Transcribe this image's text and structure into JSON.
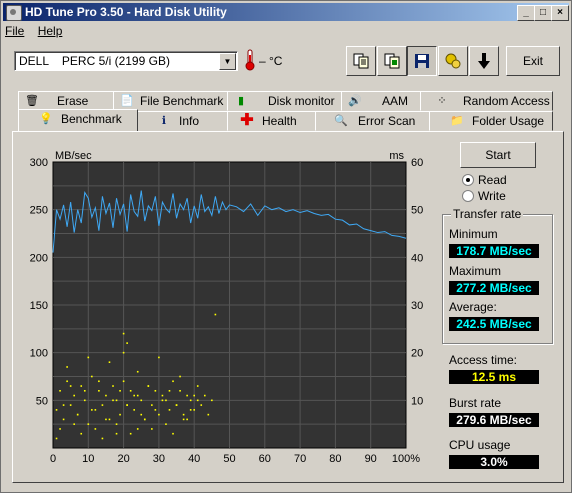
{
  "window": {
    "title": "HD Tune Pro 3.50 - Hard Disk Utility",
    "buttons": {
      "minimize": "_",
      "maximize": "□",
      "close": "×"
    }
  },
  "menu": [
    {
      "label": "File",
      "hotkey": "F"
    },
    {
      "label": "Help",
      "hotkey": "H"
    }
  ],
  "toolbar": {
    "drive": "DELL    PERC 5/i (2199 GB)",
    "temperature": "– °C",
    "icons": [
      "copy-text-icon",
      "copy-info-icon",
      "save-icon",
      "options-icon",
      "download-icon"
    ],
    "exit_label": "Exit"
  },
  "tabs_top": [
    {
      "label": "Erase",
      "icon": "trash-icon"
    },
    {
      "label": "File Benchmark",
      "icon": "file-benchmark-icon"
    },
    {
      "label": "Disk monitor",
      "icon": "disk-monitor-icon"
    },
    {
      "label": "AAM",
      "icon": "speaker-icon"
    },
    {
      "label": "Random Access",
      "icon": "random-access-icon"
    }
  ],
  "tabs_bottom": [
    {
      "label": "Benchmark",
      "icon": "lightbulb-icon",
      "active": true
    },
    {
      "label": "Info",
      "icon": "info-icon"
    },
    {
      "label": "Health",
      "icon": "health-cross-icon"
    },
    {
      "label": "Error Scan",
      "icon": "magnifier-icon"
    },
    {
      "label": "Folder Usage",
      "icon": "folder-icon"
    }
  ],
  "controls": {
    "start_label": "Start",
    "read_label": "Read",
    "write_label": "Write",
    "mode_selected": "Read"
  },
  "results": {
    "transfer_rate_title": "Transfer rate",
    "minimum_label": "Minimum",
    "minimum_value": "178.7 MB/sec",
    "maximum_label": "Maximum",
    "maximum_value": "277.2 MB/sec",
    "average_label": "Average:",
    "average_value": "242.5 MB/sec",
    "access_time_label": "Access time:",
    "access_time_value": "12.5 ms",
    "burst_rate_label": "Burst rate",
    "burst_rate_value": "279.6 MB/sec",
    "cpu_usage_label": "CPU usage",
    "cpu_usage_value": "3.0%"
  },
  "chart_data": {
    "type": "line",
    "left_unit": "MB/sec",
    "right_unit": "ms",
    "left_ticks": [
      50,
      100,
      150,
      200,
      250,
      300
    ],
    "right_ticks": [
      10,
      20,
      30,
      40,
      50,
      60
    ],
    "x_ticks": [
      "0",
      "10",
      "20",
      "30",
      "40",
      "50",
      "60",
      "70",
      "80",
      "90",
      "100%"
    ],
    "ylim": [
      0,
      300
    ],
    "y2lim": [
      0,
      60
    ],
    "xlim": [
      0,
      100
    ],
    "grid": true,
    "colors": {
      "background": "#333333",
      "grid": "#555555",
      "transfer": "#3fa9f5",
      "access": "#ffff00"
    },
    "series": [
      {
        "name": "Transfer rate",
        "axis": "left",
        "x": [
          0,
          1,
          2,
          3,
          4,
          5,
          6,
          7,
          8,
          9,
          10,
          11,
          12,
          13,
          14,
          15,
          16,
          17,
          18,
          19,
          20,
          21,
          22,
          23,
          24,
          25,
          26,
          27,
          28,
          29,
          30,
          31,
          32,
          33,
          34,
          35,
          36,
          37,
          38,
          39,
          40,
          41,
          42,
          43,
          44,
          45,
          46,
          47,
          48,
          49,
          50,
          52,
          54,
          56,
          58,
          60,
          62,
          64,
          66,
          68,
          70,
          72,
          74,
          76,
          78,
          80,
          82,
          84,
          86,
          88,
          90,
          92,
          94,
          96,
          98,
          100
        ],
        "values": [
          205,
          250,
          240,
          255,
          232,
          258,
          226,
          250,
          236,
          268,
          262,
          242,
          252,
          228,
          264,
          246,
          257,
          231,
          262,
          245,
          256,
          227,
          266,
          248,
          243,
          270,
          238,
          254,
          249,
          264,
          233,
          258,
          251,
          247,
          267,
          241,
          256,
          250,
          262,
          236,
          254,
          241,
          266,
          248,
          253,
          244,
          264,
          246,
          258,
          250,
          255,
          253,
          248,
          256,
          244,
          254,
          250,
          252,
          248,
          250,
          247,
          249,
          246,
          244,
          245,
          240,
          239,
          234,
          235,
          230,
          228,
          226,
          227,
          223,
          222,
          220
        ]
      },
      {
        "name": "Access time",
        "axis": "right",
        "x": [
          1,
          2,
          3,
          4,
          5,
          6,
          7,
          8,
          9,
          10,
          11,
          12,
          13,
          14,
          15,
          16,
          17,
          18,
          19,
          20,
          21,
          22,
          23,
          24,
          25,
          26,
          27,
          28,
          29,
          30,
          31,
          32,
          33,
          34,
          35,
          36,
          37,
          38,
          39,
          40,
          41,
          42,
          43,
          44,
          45,
          2,
          4,
          6,
          8,
          10,
          12,
          14,
          16,
          18,
          20,
          22,
          24,
          26,
          28,
          30,
          32,
          34,
          36,
          38,
          40,
          3,
          5,
          7,
          9,
          11,
          13,
          15,
          17,
          19,
          21,
          23,
          25,
          27,
          29,
          31,
          33,
          35,
          37,
          39,
          41,
          20,
          21,
          1,
          46,
          24,
          18
        ],
        "values": [
          8,
          12,
          6,
          14,
          9,
          11,
          7,
          13,
          10,
          5,
          15,
          8,
          12,
          9,
          11,
          6,
          13,
          10,
          7,
          14,
          9,
          12,
          8,
          11,
          10,
          6,
          13,
          9,
          12,
          7,
          11,
          10,
          8,
          14,
          9,
          12,
          7,
          11,
          10,
          8,
          13,
          9,
          11,
          7,
          10,
          4,
          17,
          5,
          3,
          19,
          4,
          2,
          18,
          5,
          20,
          3,
          16,
          6,
          4,
          19,
          5,
          3,
          15,
          6,
          11,
          9,
          13,
          7,
          12,
          8,
          14,
          6,
          10,
          12,
          9,
          11,
          7,
          13,
          8,
          10,
          12,
          9,
          6,
          8,
          10,
          24,
          22,
          2,
          28,
          4,
          3
        ]
      }
    ]
  }
}
